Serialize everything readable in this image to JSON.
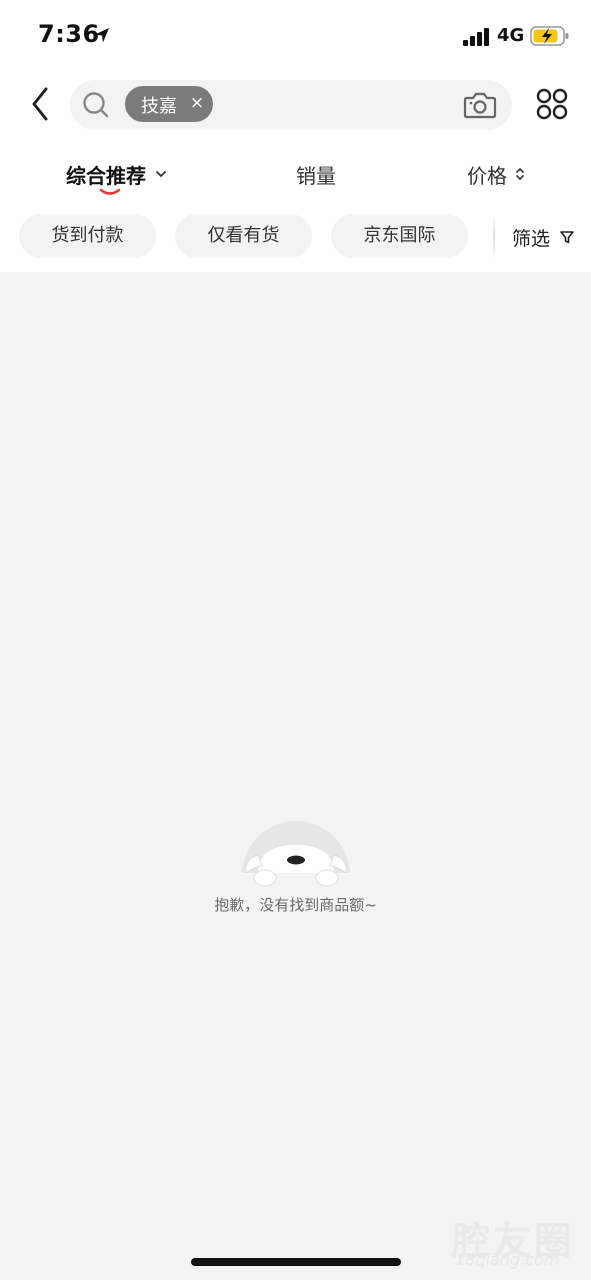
{
  "status_bar": {
    "time": "7:36",
    "network": "4G",
    "battery_color": "#f5c518"
  },
  "search": {
    "keyword_chip": "技嘉",
    "chip_close": "×"
  },
  "sort_tabs": [
    {
      "label": "综合推荐",
      "active": true
    },
    {
      "label": "销量",
      "active": false
    },
    {
      "label": "价格",
      "active": false
    }
  ],
  "filters": [
    {
      "label": "货到付款"
    },
    {
      "label": "仅看有货"
    },
    {
      "label": "京东国际"
    }
  ],
  "filter_button": {
    "label": "筛选"
  },
  "empty_state": {
    "message": "抱歉，没有找到商品额~"
  },
  "watermark": {
    "text": "腔友圈",
    "sub": "18qiang.com"
  },
  "colors": {
    "accent": "#e4393c",
    "chip_bg": "#7b7b7b",
    "page_bg": "#f3f3f3"
  }
}
